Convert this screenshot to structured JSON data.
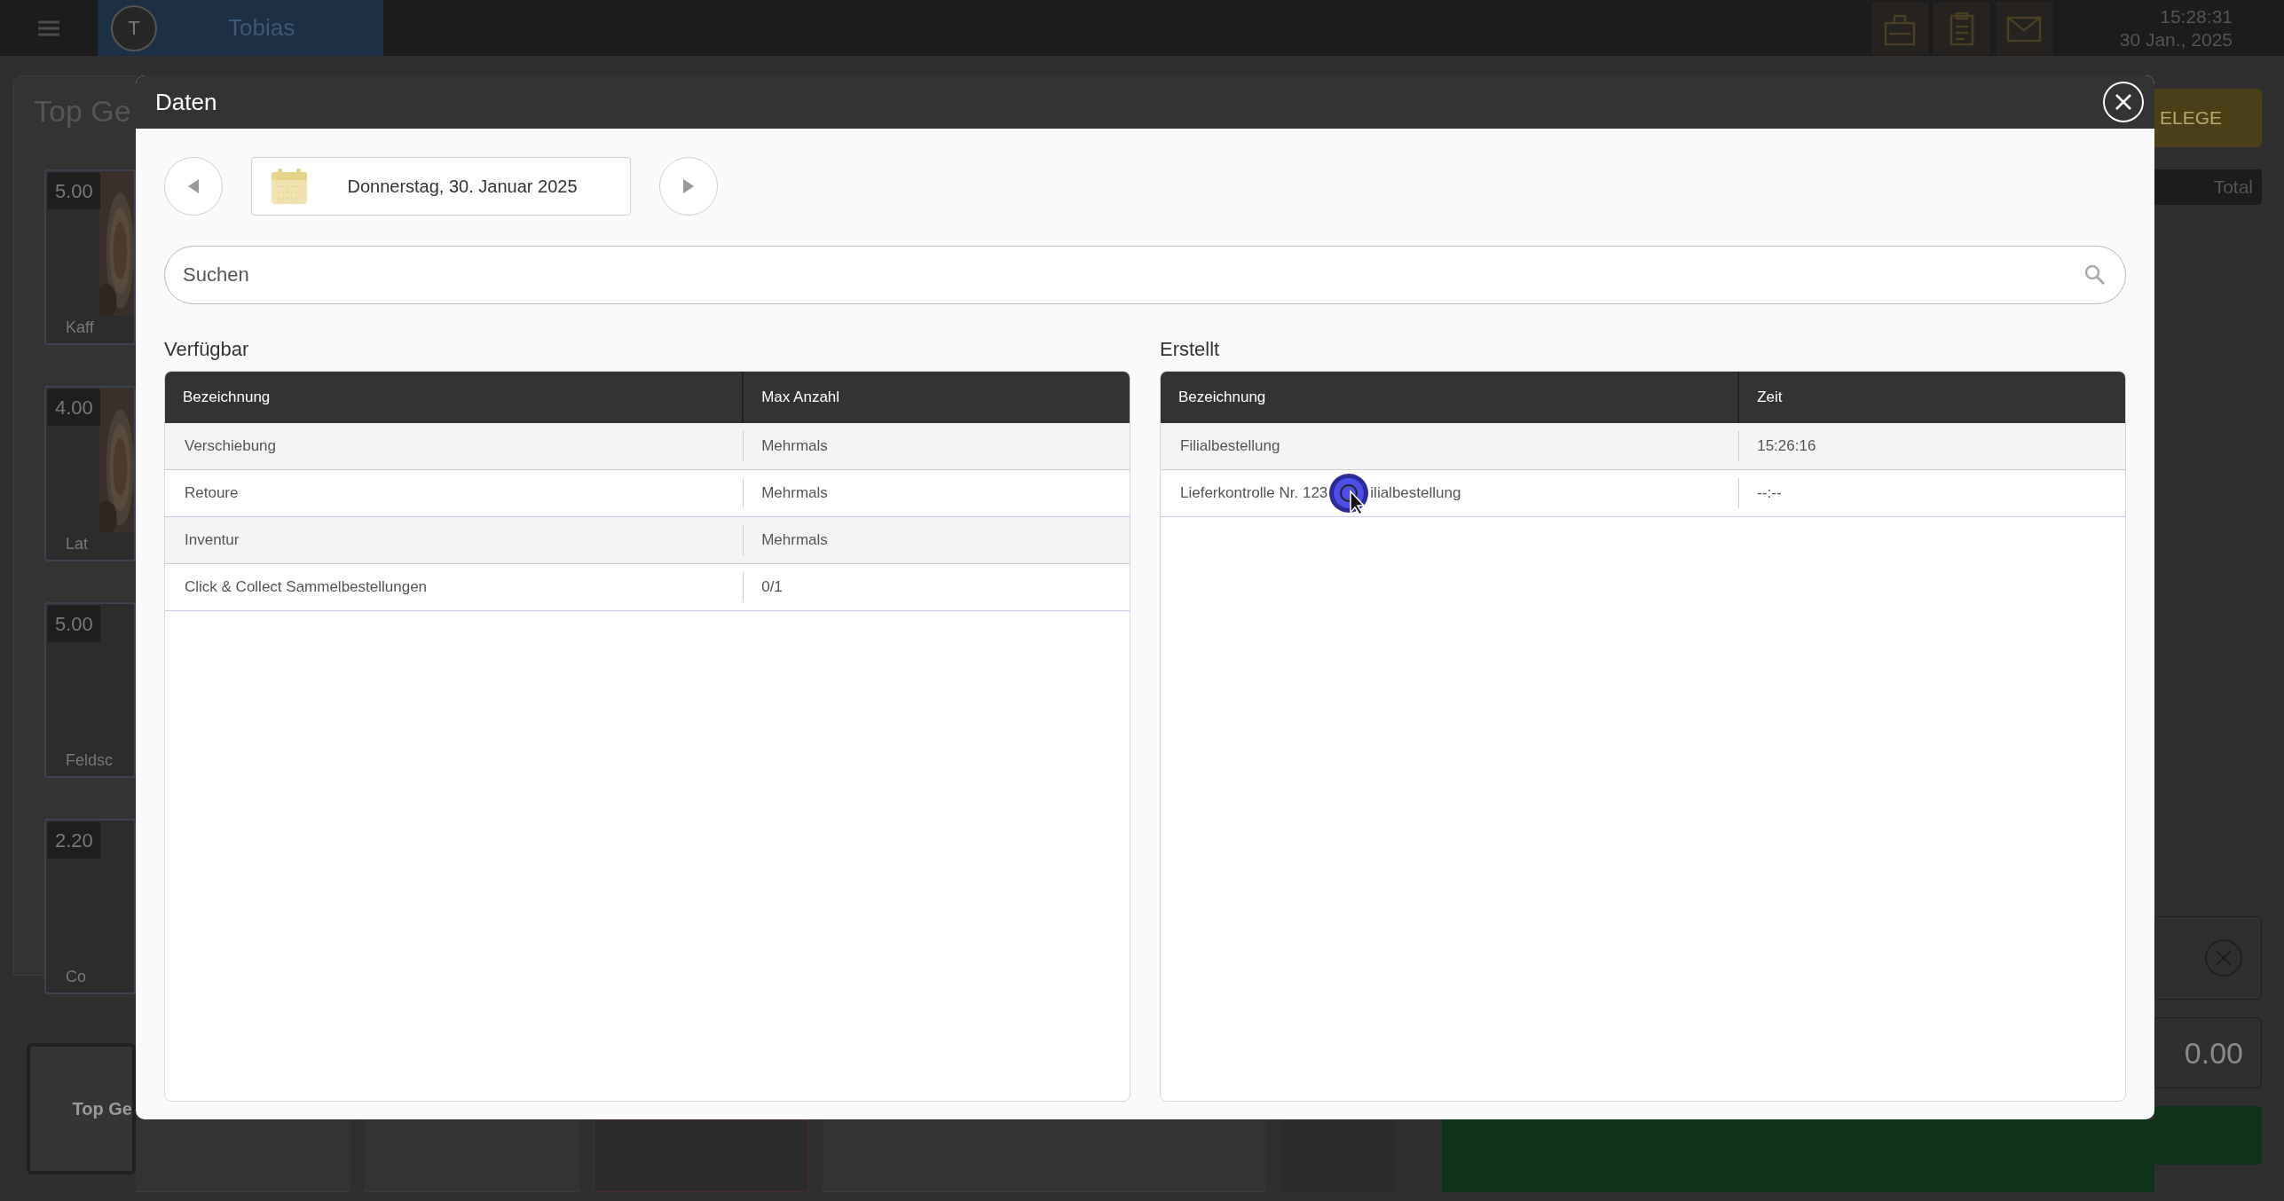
{
  "top_bar": {
    "user_initial": "T",
    "user_name": "Tobias",
    "time": "15:28:31",
    "date": "30 Jan., 2025"
  },
  "background": {
    "title": "Top Ge",
    "tiles": [
      {
        "price": "5.00",
        "label": "Kaff"
      },
      {
        "price": "4.00",
        "label": "Lat"
      },
      {
        "price": "5.00",
        "label": "Feldsc",
        "kind": "plain"
      },
      {
        "price": "2.20",
        "label": "Co",
        "kind": "plain"
      }
    ],
    "category_button": "Top Ge",
    "action_button": "ELEGE",
    "total_label": "Total",
    "amount": "0.00"
  },
  "dialog": {
    "title": "Daten",
    "date": "Donnerstag, 30. Januar 2025",
    "search": {
      "placeholder": "Suchen"
    },
    "available": {
      "title": "Verfügbar",
      "columns": [
        "Bezeichnung",
        "Max Anzahl"
      ],
      "rows": [
        {
          "cells": [
            "Verschiebung",
            "Mehrmals"
          ]
        },
        {
          "cells": [
            "Retoure",
            "Mehrmals"
          ]
        },
        {
          "cells": [
            "Inventur",
            "Mehrmals"
          ]
        },
        {
          "cells": [
            "Click & Collect Sammelbestellungen",
            "0/1"
          ]
        }
      ]
    },
    "created": {
      "title": "Erstellt",
      "columns": [
        "Bezeichnung",
        "Zeit"
      ],
      "rows": [
        {
          "name_parts": [
            "Filialbestellung"
          ],
          "time": "15:26:16"
        },
        {
          "name_parts": [
            "Lieferkontrolle Nr. 123",
            "ilialbestellung"
          ],
          "time": "--:--"
        }
      ]
    }
  }
}
